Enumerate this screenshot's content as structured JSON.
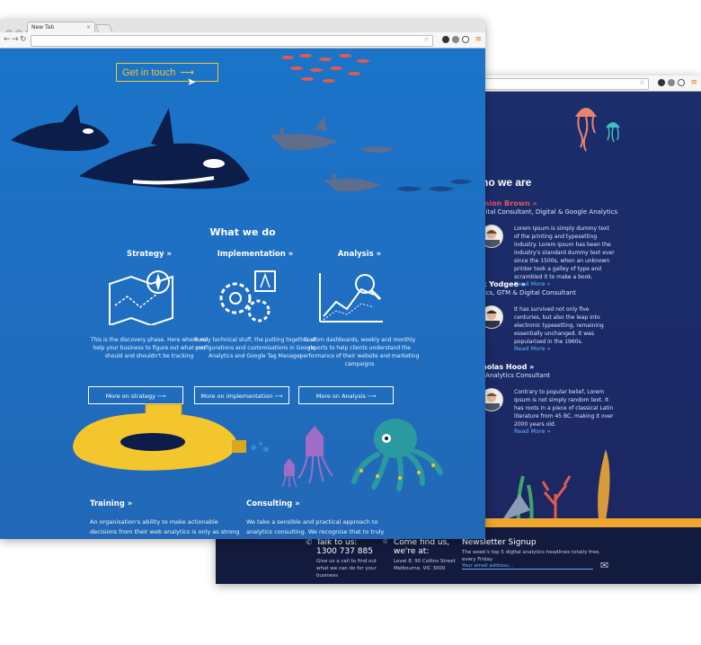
{
  "front_window": {
    "tab_title": "New Tab",
    "cta_label": "Get in touch",
    "section_title": "What we do",
    "services": [
      {
        "title": "Strategy »",
        "text": "This is the discovery phase. Here where we help your business to figure out what you should and shouldn't be tracking",
        "button": "More on strategy"
      },
      {
        "title": "Implementation »",
        "text": "Purely technical stuff, the putting together of configurations and customisations in Google Analytics and Google Tag Manager",
        "button": "More on implementation"
      },
      {
        "title": "Analysis »",
        "text": "Custom dashboards, weekly and monthly reports to help clients understand the performance of their website and marketing campaigns",
        "button": "More on Analysis"
      }
    ],
    "training": {
      "title": "Training »",
      "text": "An organisation's ability to make actionable decisions from their web analytics is only as strong as their ability to interpret. Chances are the people responsible for your web analytics aren't web analysts."
    },
    "consulting": {
      "title": "Consulting »",
      "text": "We take a sensible and practical approach to analytics consulting. We recognise that to truly become a data-driven organisation, you need to have systems and platforms that are up to the job."
    }
  },
  "back_window": {
    "section_title": "ho we are",
    "people": [
      {
        "name": "mion Brown »",
        "role": "gital Consultant, Digital & Google Analytics",
        "bio": "Lorem Ipsum is simply dummy text of the printing and typesetting industry. Lorem Ipsum has been the industry's standard dummy text ever since the 1500s, when an unknown printer took a galley of type and scrambled it to make a book.",
        "read_more": "Read More »"
      },
      {
        "name": "k Yodgee »",
        "role": "tics, GTM & Digital Consultant",
        "bio": "It has survived not only five centuries, but also the leap into electronic typesetting, remaining essentially unchanged. It was popularised in the 1960s.",
        "read_more": "Read More »"
      },
      {
        "name": "holas Hood »",
        "role": "l Analytics Consultant",
        "bio": "Contrary to popular belief, Lorem Ipsum is not simply random text. It has roots in a piece of classical Latin literature from 45 BC, making it over 2000 years old.",
        "read_more": "Read More »"
      }
    ],
    "footer": {
      "talk_title": "Talk to us:",
      "phone": "1300 737 885",
      "talk_text": "Give us a call to find out what we can do for your business",
      "find_title": "Come find us, we're at:",
      "address": "Level 8, 90 Collins Street Melbourne, VIC 3000",
      "newsletter_title": "Newsletter Signup",
      "newsletter_text": "The week's top 5 digital analytics headlines totally free, every Friday",
      "email_placeholder": "Your email address..."
    }
  },
  "colors": {
    "accent": "#f3c62d",
    "link": "#5fb6ff",
    "name_highlight": "#e05367"
  }
}
